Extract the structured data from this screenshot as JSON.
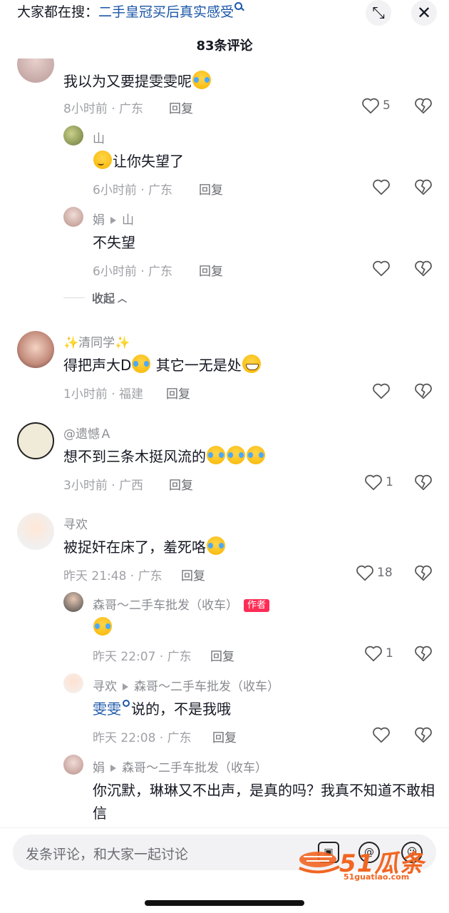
{
  "header": {
    "search_prefix": "大家都在搜：",
    "search_query": "二手皇冠买后真实感受",
    "collapse_icon": "collapse-icon",
    "close_icon": "close-icon",
    "comment_count_title": "83条评论"
  },
  "comments": [
    {
      "text": "我以为又要提雯雯呢",
      "time_location": "8小时前 · 广东",
      "reply_label": "回复",
      "likes": "5",
      "replies": [
        {
          "user": "山",
          "text": "让你失望了",
          "time_location": "6小时前 · 广东",
          "reply_label": "回复",
          "likes": ""
        },
        {
          "user": "娟",
          "reply_to": "山",
          "text": "不失望",
          "time_location": "6小时前 · 广东",
          "reply_label": "回复",
          "likes": ""
        }
      ],
      "collapse_label": "收起"
    },
    {
      "user": "✨清同学✨",
      "text_a": "得把声大D",
      "text_b": " 其它一无是处",
      "time_location": "1小时前 · 福建",
      "reply_label": "回复",
      "likes": ""
    },
    {
      "user": "@遗憾Ａ",
      "text": "想不到三条木挺风流的",
      "time_location": "3小时前 · 广西",
      "reply_label": "回复",
      "likes": "1"
    },
    {
      "user": "寻欢",
      "text": "被捉奸在床了，羞死咯",
      "time_location": "昨天 21:48 · 广东",
      "reply_label": "回复",
      "likes": "18",
      "replies": [
        {
          "user": "森哥～二手车批发（收车）",
          "author_tag": "作者",
          "text": "",
          "time_location": "昨天 22:07 · 广东",
          "reply_label": "回复",
          "likes": "1"
        },
        {
          "user": "寻欢",
          "reply_to": "森哥～二手车批发（收车）",
          "mention": "雯雯",
          "text": "说的，不是我哦",
          "time_location": "昨天 22:08 · 广东",
          "reply_label": "回复",
          "likes": ""
        },
        {
          "user": "娟",
          "reply_to": "森哥～二手车批发（收车）",
          "text": "你沉默，琳琳又不出声，是真的吗？我真不知道不敢相信"
        }
      ]
    }
  ],
  "bottom_bar": {
    "placeholder": "发条评论，和大家一起讨论",
    "icons": [
      "image-icon",
      "at-icon",
      "emoji-icon"
    ],
    "watermark_text": "51瓜条",
    "watermark_url": "51guatiao.com"
  },
  "colors": {
    "link_blue": "#1a56a8",
    "author_tag_red": "#fe2c55",
    "watermark_orange": "#f26522"
  }
}
